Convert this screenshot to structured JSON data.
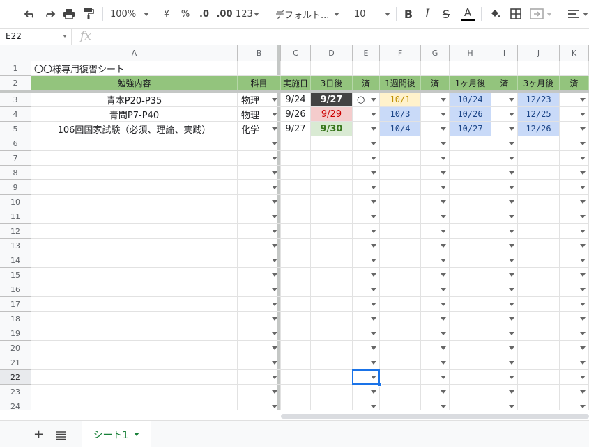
{
  "toolbar": {
    "zoom": "100%",
    "currency": "¥",
    "percent": "%",
    "dec_decrease": ".0",
    "dec_increase": ".00",
    "format_more": "123",
    "font_family": "デフォルト...",
    "font_size": "10"
  },
  "formula_bar": {
    "cell_ref": "E22",
    "fx": "fx",
    "content": ""
  },
  "columns": [
    "A",
    "B",
    "C",
    "D",
    "E",
    "F",
    "G",
    "H",
    "I",
    "J",
    "K"
  ],
  "rows": [
    "1",
    "2",
    "3",
    "4",
    "5",
    "6",
    "7",
    "8",
    "9",
    "10",
    "11",
    "12",
    "13",
    "14",
    "15",
    "16",
    "17",
    "18",
    "19",
    "20",
    "21",
    "22",
    "23",
    "24"
  ],
  "sheet": {
    "title": "〇〇様専用復習シート",
    "headers": [
      "勉強内容",
      "科目",
      "実施日",
      "3日後",
      "済",
      "1週間後",
      "済",
      "1ヶ月後",
      "済",
      "3ヶ月後",
      "済"
    ],
    "records": [
      {
        "content": "青本P20-P35",
        "subject": "物理",
        "date": "9/24",
        "d3": "9/27",
        "done3": "○",
        "w1": "10/1",
        "m1": "10/24",
        "m3": "12/23"
      },
      {
        "content": "青問P7-P40",
        "subject": "物理",
        "date": "9/26",
        "d3": "9/29",
        "done3": "",
        "w1": "10/3",
        "m1": "10/26",
        "m3": "12/25"
      },
      {
        "content": "106回国家試験（必須、理論、実践）",
        "subject": "化学",
        "date": "9/27",
        "d3": "9/30",
        "done3": "",
        "w1": "10/4",
        "m1": "10/27",
        "m3": "12/26"
      }
    ]
  },
  "colors": {
    "header_green": "#93c47d",
    "d3_dark": "#434343",
    "d3_pink": "#f4cccc",
    "d3_pink_text": "#cc0000",
    "d3_green": "#d9ead3",
    "d3_green_text": "#38761d",
    "w1_yellow": "#fff2cc",
    "w1_yellow_text": "#bf9000",
    "blue": "#c9daf8",
    "blue_text": "#1c4587",
    "select_blue": "#1a73e8"
  },
  "tabs": {
    "sheet1": "シート1"
  }
}
